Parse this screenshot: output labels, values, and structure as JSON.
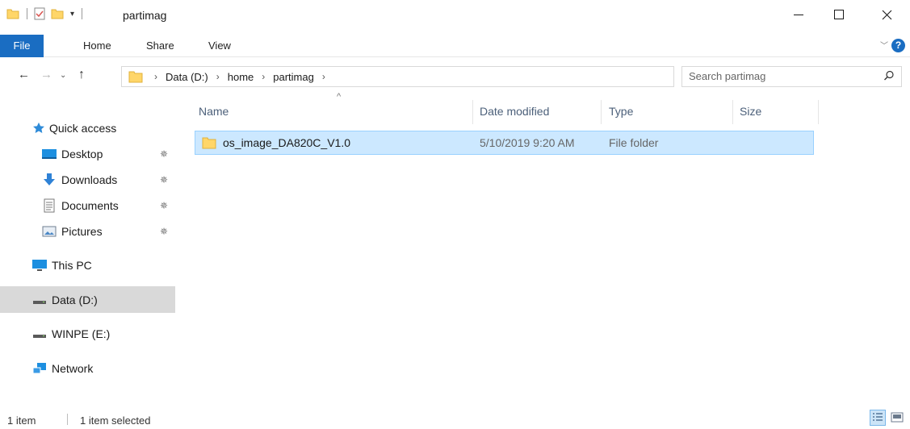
{
  "window": {
    "title": "partimag"
  },
  "ribbon": {
    "tabs": [
      {
        "label": "File",
        "active": true
      },
      {
        "label": "Home"
      },
      {
        "label": "Share"
      },
      {
        "label": "View"
      }
    ],
    "help_label": "?"
  },
  "address": {
    "breadcrumbs": [
      "Data (D:)",
      "home",
      "partimag"
    ]
  },
  "search": {
    "placeholder": "Search partimag"
  },
  "nav_pane": {
    "quick_access": "Quick access",
    "pinned": [
      {
        "label": "Desktop"
      },
      {
        "label": "Downloads"
      },
      {
        "label": "Documents"
      },
      {
        "label": "Pictures"
      }
    ],
    "this_pc": "This PC",
    "data_drive": "Data (D:)",
    "winpe_drive": "WINPE (E:)",
    "network": "Network"
  },
  "file_list": {
    "columns": [
      "Name",
      "Date modified",
      "Type",
      "Size"
    ],
    "rows": [
      {
        "name": "os_image_DA820C_V1.0",
        "date": "5/10/2019 9:20 AM",
        "type": "File folder",
        "size": ""
      }
    ]
  },
  "status_bar": {
    "item_count": "1 item",
    "selected_count": "1 item selected"
  },
  "colors": {
    "accent": "#1a6dc2",
    "selection_bg": "#cce8ff",
    "selection_border": "#99d1ff",
    "folder": "#ffd669"
  }
}
